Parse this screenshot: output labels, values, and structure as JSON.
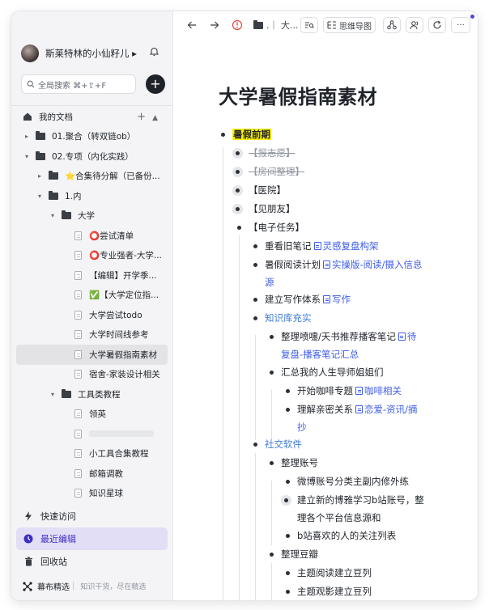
{
  "sidebar": {
    "username": "斯莱特林的小仙籽儿 ▸",
    "search_placeholder": "全局搜索 ⌘+⇧+F",
    "add_button": "+",
    "tree": [
      {
        "label": "我的文档",
        "type": "root"
      },
      {
        "label": "01.聚合（转双链ob）",
        "type": "folder",
        "caret": "▸"
      },
      {
        "label": "02.专项（内化实践）",
        "type": "folder",
        "caret": "▾"
      },
      {
        "label": "⭐️合集待分解（已备份...",
        "type": "folder",
        "caret": "▸"
      },
      {
        "label": "1.内",
        "type": "folder",
        "caret": "▾"
      },
      {
        "label": "大学",
        "type": "folder",
        "caret": "▾"
      },
      {
        "label": "⭕尝试清单",
        "type": "doc"
      },
      {
        "label": "⭕专业强者-大学...",
        "type": "doc"
      },
      {
        "label": "【编辑】开学季...",
        "type": "doc"
      },
      {
        "label": "✅【大学定位指...",
        "type": "doc"
      },
      {
        "label": "大学尝试todo",
        "type": "doc"
      },
      {
        "label": "大学时间线参考",
        "type": "doc"
      },
      {
        "label": "大学暑假指南素材",
        "type": "doc",
        "selected": true
      },
      {
        "label": "宿舍-家装设计相关",
        "type": "doc"
      },
      {
        "label": "工具类教程",
        "type": "folder",
        "caret": "▾"
      },
      {
        "label": "领英",
        "type": "doc"
      },
      {
        "label": "",
        "type": "doc"
      },
      {
        "label": "小工具合集教程",
        "type": "doc"
      },
      {
        "label": "邮箱调教",
        "type": "doc"
      },
      {
        "label": "知识星球",
        "type": "doc"
      }
    ],
    "nav": [
      {
        "label": "快速访问",
        "icon": "lightning-icon"
      },
      {
        "label": "最近编辑",
        "icon": "clock-icon",
        "active": true
      },
      {
        "label": "回收站",
        "icon": "trash-icon"
      }
    ],
    "footer": {
      "brand": "幕布精选",
      "sub": "知识干货，尽在精选"
    }
  },
  "toolbar": {
    "breadcrumb": ".｜ 大...",
    "mindmap_label": "思维导图",
    "more": "···"
  },
  "doc": {
    "title": "大学暑假指南素材",
    "items": [
      {
        "text": "暑假前期",
        "style": "highlight"
      },
      {
        "text": "【报志愿】",
        "style": "strike"
      },
      {
        "text": "【房间整理】",
        "style": "strike"
      },
      {
        "text": "【医院】"
      },
      {
        "text": "【见朋友】"
      },
      {
        "text": "【电子任务】"
      },
      {
        "text": "重看旧笔记",
        "link": "灵感复盘构架"
      },
      {
        "text": "暑假阅读计划",
        "link": "实操版-阅读/摄入信息",
        "link2": "源"
      },
      {
        "text": "建立写作体系",
        "link": "写作"
      },
      {
        "text": "知识库充实",
        "style": "blue"
      },
      {
        "text": "整理喷嚏/天书推荐播客笔记",
        "link": "待",
        "link2": "复盘-播客笔记汇总"
      },
      {
        "text": "汇总我的人生导师姐姐们"
      },
      {
        "text": "开始咖啡专题",
        "link": "咖啡相关"
      },
      {
        "text": "理解亲密关系",
        "link": "恋爱-资讯/摘",
        "link2": "抄"
      },
      {
        "text": "社交软件",
        "style": "blue"
      },
      {
        "text": "整理账号"
      },
      {
        "text": "微博账号分类主副内修外练"
      },
      {
        "text": "建立新的博雅学习b站账号，整",
        "line2": "理各个平台信息源和"
      },
      {
        "text": "b站喜欢的人的关注列表"
      },
      {
        "text": "整理豆瓣"
      },
      {
        "text": "主题阅读建立豆列"
      },
      {
        "text": "主题观影建立豆列"
      }
    ]
  }
}
